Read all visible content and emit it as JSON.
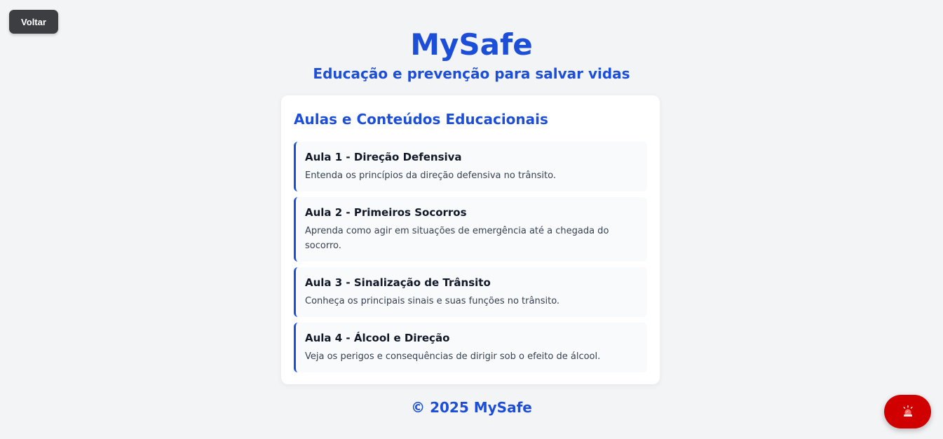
{
  "nav": {
    "back_label": "Voltar"
  },
  "header": {
    "title": "MySafe",
    "subtitle": "Educação e prevenção para salvar vidas"
  },
  "content": {
    "section_title": "Aulas e Conteúdos Educacionais",
    "lessons": [
      {
        "title": "Aula 1 - Direção Defensiva",
        "description": "Entenda os princípios da direção defensiva no trânsito."
      },
      {
        "title": "Aula 2 - Primeiros Socorros",
        "description": "Aprenda como agir em situações de emergência até a chegada do socorro."
      },
      {
        "title": "Aula 3 - Sinalização de Trânsito",
        "description": "Conheça os principais sinais e suas funções no trânsito."
      },
      {
        "title": "Aula 4 - Álcool e Direção",
        "description": "Veja os perigos e consequências de dirigir sob o efeito de álcool."
      }
    ]
  },
  "footer": {
    "text": "© 2025 MySafe"
  },
  "emergency": {
    "icon": "siren-icon"
  },
  "colors": {
    "accent": "#1d4ed8",
    "background": "#f3f4f6",
    "emergency": "#d00000",
    "back_button": "#3c3e42"
  }
}
